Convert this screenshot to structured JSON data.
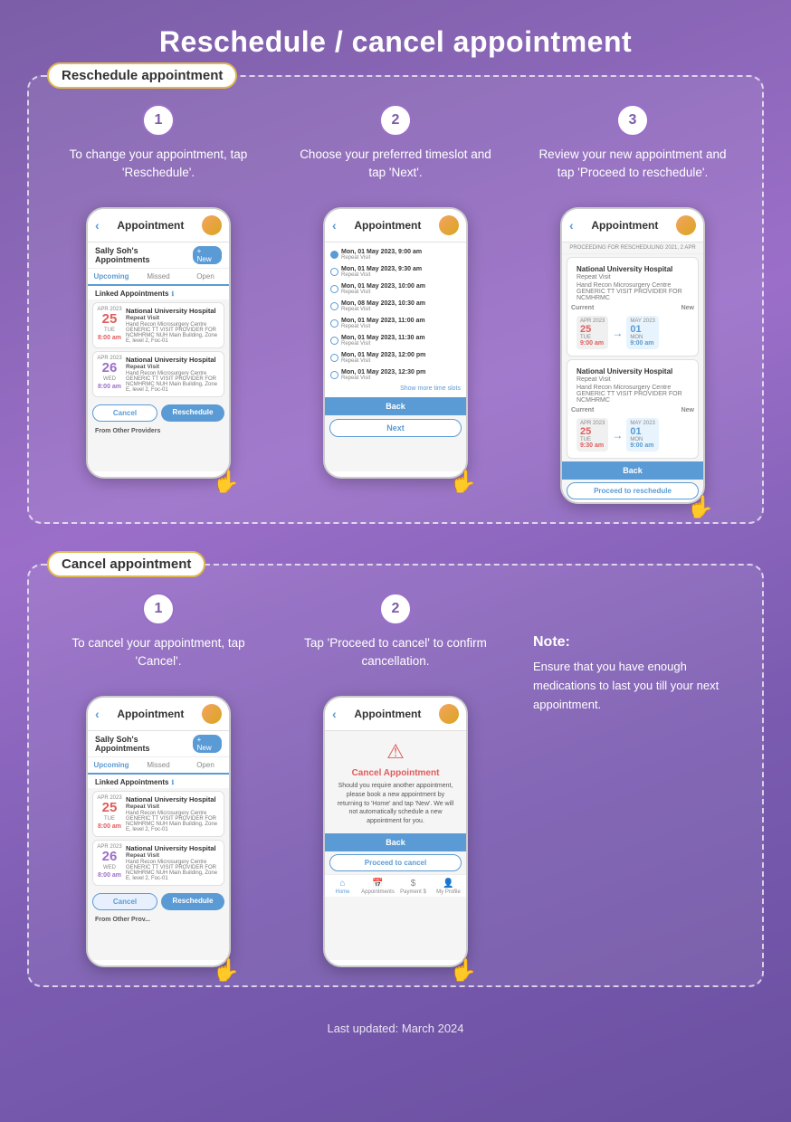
{
  "page": {
    "title": "Reschedule / cancel appointment",
    "footer": "Last updated: March 2024"
  },
  "reschedule_section": {
    "label": "Reschedule appointment",
    "steps": [
      {
        "number": "1",
        "text": "To change your appointment, tap 'Reschedule'."
      },
      {
        "number": "2",
        "text": "Choose your preferred timeslot and tap 'Next'."
      },
      {
        "number": "3",
        "text": "Review your new appointment and tap 'Proceed to reschedule'."
      }
    ]
  },
  "cancel_section": {
    "label": "Cancel appointment",
    "steps": [
      {
        "number": "1",
        "text": "To cancel your appointment, tap 'Cancel'."
      },
      {
        "number": "2",
        "text": "Tap 'Proceed to cancel' to confirm cancellation."
      }
    ],
    "note": {
      "title": "Note:",
      "text": "Ensure that you have enough medications to last you till your next appointment."
    }
  },
  "phone1": {
    "header": "Appointment",
    "user": "Sally Soh's Appointments",
    "tabs": [
      "Upcoming",
      "Missed",
      "Open"
    ],
    "linked_appointments": "Linked Appointments",
    "cards": [
      {
        "month_year": "APR 2023",
        "day_num": "25",
        "day_name": "TUE",
        "time": "8:00 am",
        "hospital": "National University Hospital",
        "type": "Repeat Visit",
        "dept": "Hand Recon Microsurgery Centre GENERIC TT VISIT PROVIDER FOR NCMHRMC NUH Main Building, Zone E, level 2, Foc-01"
      },
      {
        "month_year": "APR 2023",
        "day_num": "26",
        "day_name": "WED",
        "time": "8:00 am",
        "hospital": "National University Hospital",
        "type": "Repeat Visit",
        "dept": "Hand Recon Microsurgery Centre GENERIC TT VISIT PROVIDER FOR NCMHRMC NUH Main Building, Zone E, level 2, Foc-01"
      }
    ],
    "btn_cancel": "Cancel",
    "btn_reschedule": "Reschedule",
    "from_other": "From Other Providers"
  },
  "phone2": {
    "header": "Appointment",
    "timeslots": [
      {
        "time": "Mon, 01 May 2023, 9:00 am",
        "type": "Repeat Visit",
        "selected": true
      },
      {
        "time": "Mon, 01 May 2023, 9:30 am",
        "type": "Repeat Visit",
        "selected": false
      },
      {
        "time": "Mon, 01 May 2023, 10:00 am",
        "type": "Repeat Visit",
        "selected": false
      },
      {
        "time": "Mon, 08 May 2023, 10:30 am",
        "type": "Repeat Visit",
        "selected": false
      },
      {
        "time": "Mon, 01 May 2023, 11:00 am",
        "type": "Repeat Visit",
        "selected": false
      },
      {
        "time": "Mon, 01 May 2023, 11:30 am",
        "type": "Repeat Visit",
        "selected": false
      },
      {
        "time": "Mon, 01 May 2023, 11:30 am",
        "type": "Repeat Visit",
        "selected": false
      },
      {
        "time": "Mon, 01 May 2023, 12:00 pm",
        "type": "Repeat Visit",
        "selected": false
      },
      {
        "time": "Mon, 01 May 2023, 12:30 pm",
        "type": "Repeat Visit",
        "selected": false
      }
    ],
    "show_more": "Show more time slots",
    "btn_back": "Back",
    "btn_next": "Next"
  },
  "phone3": {
    "header": "Appointment",
    "appointments": [
      {
        "hospital": "National University Hospital",
        "type": "Repeat Visit",
        "dept": "Hand Recon Microsurgery Centre GENERIC TT VISIT PROVIDER FOR NCMHRMC",
        "current": {
          "month": "APR 2023",
          "day": "25",
          "dow": "TUE",
          "time": "9:00 am"
        },
        "new": {
          "month": "MAY 2023",
          "day": "01",
          "dow": "MON",
          "time": "9:00 am"
        }
      },
      {
        "hospital": "National University Hospital",
        "type": "Repeat Visit",
        "dept": "Hand Recon Microsurgery Centre GENERIC TT VISIT PROVIDER FOR NCMHRMC",
        "current": {
          "month": "APR 2023",
          "day": "25",
          "dow": "TUE",
          "time": "9:30 am"
        },
        "new": {
          "month": "MAY 2023",
          "day": "01",
          "dow": "MON",
          "time": "9:00 am"
        }
      }
    ],
    "btn_back": "Back",
    "btn_proceed": "Proceed to reschedule"
  },
  "phone4": {
    "header": "Appointment",
    "user": "Sally Soh's Appointments",
    "tabs": [
      "Upcoming",
      "Missed",
      "Open"
    ],
    "btn_cancel": "Cancel",
    "btn_reschedule": "Reschedule",
    "from_other": "From Other Prov..."
  },
  "phone5": {
    "header": "Appointment",
    "cancel_title": "Cancel Appointment",
    "cancel_text": "Should you require another appointment, please book a new appointment by returning to 'Home' and tap 'New'. We will not automatically schedule a new appointment for you.",
    "btn_back": "Back",
    "btn_proceed": "Proceed to cancel",
    "nav_items": [
      "Home",
      "Appointments",
      "Payment $",
      "My Profile"
    ]
  }
}
